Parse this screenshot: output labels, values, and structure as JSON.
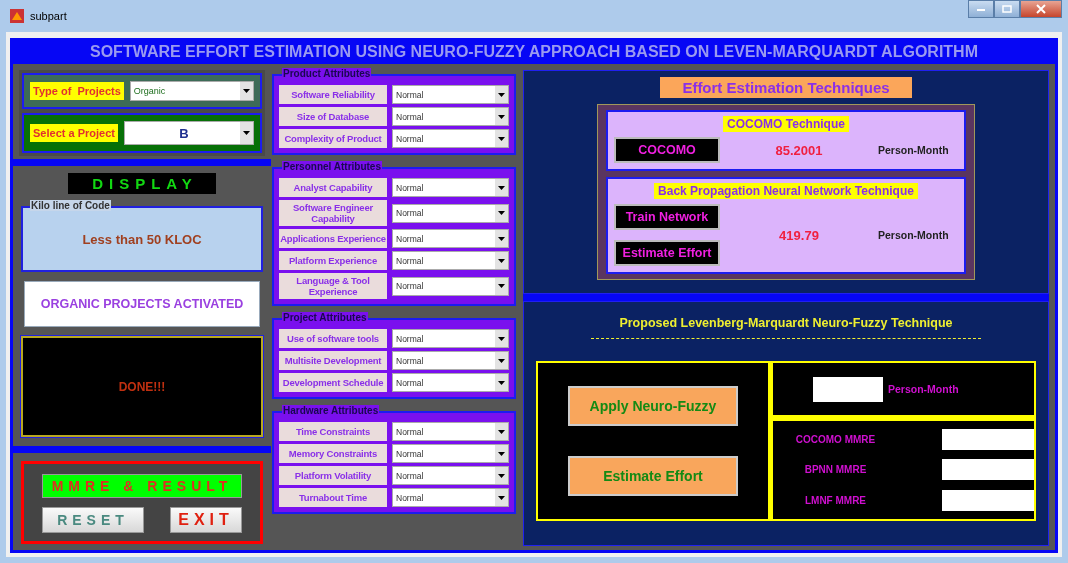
{
  "window": {
    "title": "subpart"
  },
  "banner": "SOFTWARE EFFORT ESTIMATION USING NEURO-FUZZY APPROACH BASED ON LEVEN-MARQUARDT ALGORITHM",
  "selectors": [
    {
      "label": "Type of  Projects",
      "value": "Organic",
      "kind": "small"
    },
    {
      "label": "Select a Project",
      "value": "B",
      "kind": "large"
    }
  ],
  "display": {
    "heading": "DISPLAY",
    "group_label": "Kilo line of Code",
    "kloc": "Less than 50 KLOC",
    "status": "ORGANIC PROJECTS ACTIVATED",
    "result": "DONE!!!"
  },
  "actions": [
    {
      "label": "MMRE & RESULT",
      "kind": "wide"
    },
    {
      "label": "RESET",
      "kind": "reset"
    },
    {
      "label": "EXIT",
      "kind": "exit"
    }
  ],
  "attribute_groups": [
    {
      "title": "Product Attributes",
      "attributes": [
        {
          "label": "Software Reliability",
          "value": "Normal"
        },
        {
          "label": "Size of Database",
          "value": "Normal"
        },
        {
          "label": "Complexity of Product",
          "value": "Normal"
        }
      ]
    },
    {
      "title": "Personnel Attributes",
      "attributes": [
        {
          "label": "Analyst Capability",
          "value": "Normal"
        },
        {
          "label": "Software Engineer Capability",
          "value": "Normal"
        },
        {
          "label": "Applications Experience",
          "value": "Normal"
        },
        {
          "label": "Platform Experience",
          "value": "Normal"
        },
        {
          "label": "Language & Tool Experience",
          "value": "Normal"
        }
      ]
    },
    {
      "title": "Project Attributes",
      "attributes": [
        {
          "label": "Use of software tools",
          "value": "Normal"
        },
        {
          "label": "Multisite Development",
          "value": "Normal"
        },
        {
          "label": "Development Schedule",
          "value": "Normal"
        }
      ]
    },
    {
      "title": "Hardware Attributes",
      "attributes": [
        {
          "label": "Time Constraints",
          "value": "Normal"
        },
        {
          "label": "Memory Constraints",
          "value": "Normal"
        },
        {
          "label": "Platform Volatility",
          "value": "Normal"
        },
        {
          "label": "Turnabout Time",
          "value": "Normal"
        }
      ]
    }
  ],
  "techniques": {
    "heading": "Effort Estimation Techniques",
    "items": [
      {
        "title": "COCOMO Technique",
        "buttons": [
          "COCOMO"
        ],
        "value": "85.2001",
        "unit": "Person-Month"
      },
      {
        "title": "Back Propagation Neural Network Technique",
        "buttons": [
          "Train Network",
          "Estimate Effort"
        ],
        "value": "419.79",
        "unit": "Person-Month"
      }
    ]
  },
  "proposed": {
    "title": "Proposed Levenberg-Marquardt Neuro-Fuzzy Technique",
    "buttons": [
      "Apply Neuro-Fuzzy",
      "Estimate Effort"
    ],
    "unit": "Person-Month",
    "mmre": [
      {
        "label": "COCOMO MMRE"
      },
      {
        "label": "BPNN MMRE"
      },
      {
        "label": "LMNF MMRE"
      }
    ]
  }
}
